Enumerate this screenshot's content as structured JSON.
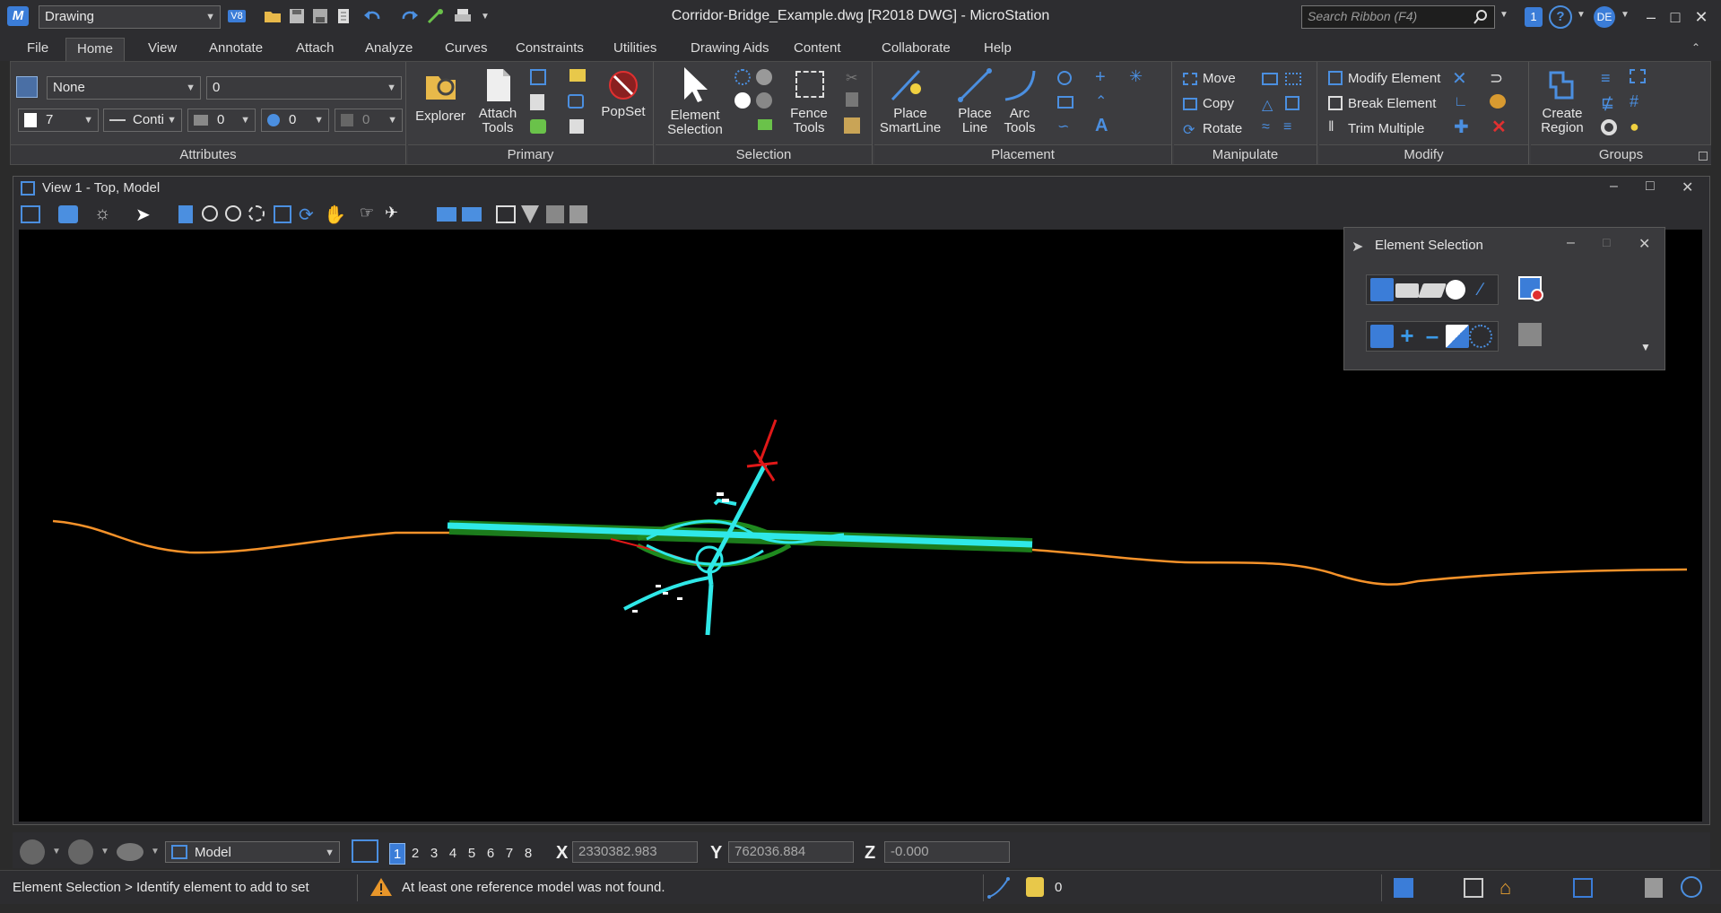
{
  "titlebar": {
    "workflow": "Drawing",
    "version_badge": "V8",
    "document_title": "Corridor-Bridge_Example.dwg [R2018 DWG] - MicroStation",
    "search_placeholder": "Search Ribbon (F4)",
    "user_initials": "DE",
    "notification_count": "1"
  },
  "tabs": [
    "File",
    "Home",
    "View",
    "Annotate",
    "Attach",
    "Analyze",
    "Curves",
    "Constraints",
    "Utilities",
    "Drawing Aids",
    "Content",
    "Collaborate",
    "Help"
  ],
  "active_tab": "Home",
  "ribbon": {
    "attributes": {
      "label": "Attributes",
      "level": "None",
      "level2": "0",
      "color": "7",
      "linestyle": "Conti",
      "weight": "0",
      "transparency": "0",
      "priority": "0"
    },
    "primary": {
      "label": "Primary",
      "explorer": "Explorer",
      "attach_tools": "Attach Tools",
      "popset": "PopSet"
    },
    "selection": {
      "label": "Selection",
      "element_selection": "Element Selection",
      "fence_tools": "Fence Tools"
    },
    "placement": {
      "label": "Placement",
      "place_smartline": "Place SmartLine",
      "place_line": "Place Line",
      "arc_tools": "Arc Tools"
    },
    "manipulate": {
      "label": "Manipulate",
      "move": "Move",
      "copy": "Copy",
      "rotate": "Rotate"
    },
    "modify": {
      "label": "Modify",
      "modify_element": "Modify Element",
      "break_element": "Break Element",
      "trim_multiple": "Trim Multiple"
    },
    "groups": {
      "label": "Groups",
      "create_region": "Create Region"
    }
  },
  "view": {
    "title": "View 1 - Top, Model"
  },
  "element_selection_dialog": {
    "title": "Element Selection"
  },
  "navbar": {
    "model": "Model",
    "view_numbers": [
      "1",
      "2",
      "3",
      "4",
      "5",
      "6",
      "7",
      "8"
    ],
    "active_view": "1",
    "x_label": "X",
    "x_value": "2330382.983",
    "y_label": "Y",
    "y_value": "762036.884",
    "z_label": "Z",
    "z_value": "-0.000"
  },
  "status": {
    "prompt": "Element Selection > Identify element to add to set",
    "message": "At least one reference model was not found.",
    "lock_count": "0"
  },
  "colors": {
    "alignment": "#f5922a",
    "corridor": "#2fe8e8",
    "grading": "#1f8a1f",
    "marker": "#e01818",
    "accent": "#3b7dd8"
  }
}
